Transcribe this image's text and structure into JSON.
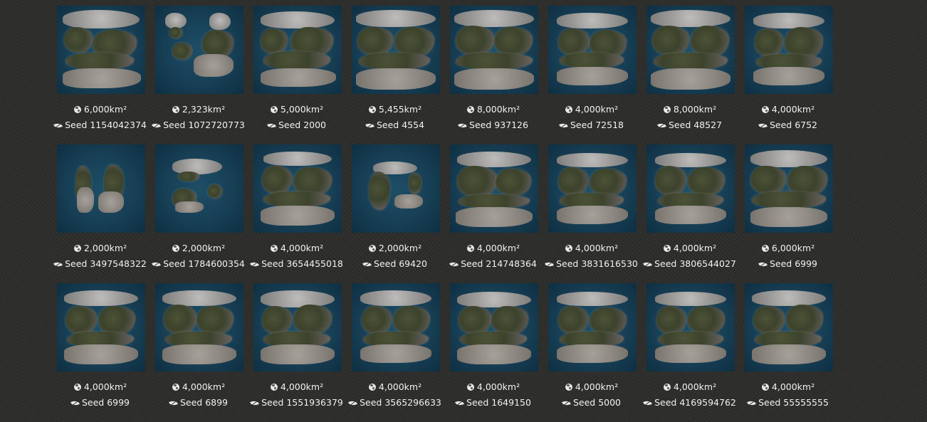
{
  "maps": [
    {
      "size": "6,000km²",
      "seed": "Seed 1154042374"
    },
    {
      "size": "2,323km²",
      "seed": "Seed 1072720773"
    },
    {
      "size": "5,000km²",
      "seed": "Seed 2000"
    },
    {
      "size": "5,455km²",
      "seed": "Seed 4554"
    },
    {
      "size": "8,000km²",
      "seed": "Seed 937126"
    },
    {
      "size": "4,000km²",
      "seed": "Seed 72518"
    },
    {
      "size": "8,000km²",
      "seed": "Seed 48527"
    },
    {
      "size": "4,000km²",
      "seed": "Seed 6752"
    },
    {
      "size": "2,000km²",
      "seed": "Seed 3497548322"
    },
    {
      "size": "2,000km²",
      "seed": "Seed 1784600354"
    },
    {
      "size": "4,000km²",
      "seed": "Seed 3654455018"
    },
    {
      "size": "2,000km²",
      "seed": "Seed 69420"
    },
    {
      "size": "4,000km²",
      "seed": "Seed 214748364"
    },
    {
      "size": "4,000km²",
      "seed": "Seed 3831616530"
    },
    {
      "size": "4,000km²",
      "seed": "Seed 3806544027"
    },
    {
      "size": "6,000km²",
      "seed": "Seed 6999"
    },
    {
      "size": "4,000km²",
      "seed": "Seed 6999"
    },
    {
      "size": "4,000km²",
      "seed": "Seed 6899"
    },
    {
      "size": "4,000km²",
      "seed": "Seed 1551936379"
    },
    {
      "size": "4,000km²",
      "seed": "Seed 3565296633"
    },
    {
      "size": "4,000km²",
      "seed": "Seed 1649150"
    },
    {
      "size": "4,000km²",
      "seed": "Seed 5000"
    },
    {
      "size": "4,000km²",
      "seed": "Seed 4169594762"
    },
    {
      "size": "4,000km²",
      "seed": "Seed 55555555"
    }
  ],
  "colors": {
    "background": "#2c2c2b",
    "ocean": "#173f55",
    "forest": "#3c432c",
    "rock": "#9b9a98",
    "text": "#f2f2f2"
  },
  "icons": {
    "size": "globe-icon",
    "seed": "leaf-icon"
  }
}
